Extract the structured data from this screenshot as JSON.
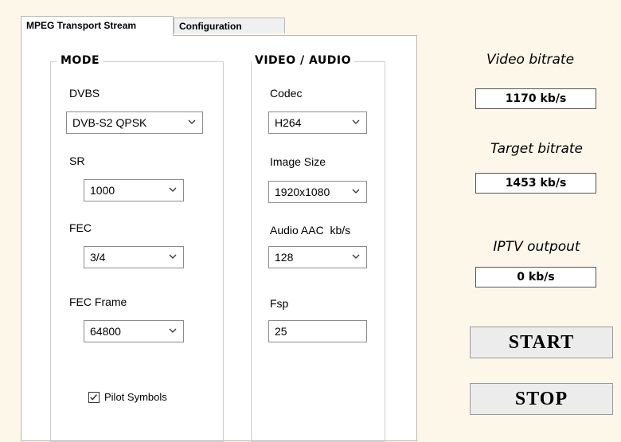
{
  "tabs": [
    {
      "label": "MPEG Transport Stream",
      "active": true
    },
    {
      "label": "Configuration",
      "active": false
    }
  ],
  "mode": {
    "title": "MODE",
    "dvbs_label": "DVBS",
    "dvbs_value": "DVB-S2 QPSK",
    "sr_label": "SR",
    "sr_value": "1000",
    "fec_label": "FEC",
    "fec_value": "3/4",
    "fec_frame_label": "FEC Frame",
    "fec_frame_value": "64800",
    "pilot_label": "Pilot Symbols",
    "pilot_checked": true
  },
  "video_audio": {
    "title": "VIDEO / AUDIO",
    "codec_label": "Codec",
    "codec_value": "H264",
    "image_size_label": "Image Size",
    "image_size_value": "1920x1080",
    "audio_label": "Audio AAC  kb/s",
    "audio_value": "128",
    "fsp_label": "Fsp",
    "fsp_value": "25"
  },
  "stats": {
    "video_bitrate_label": "Video bitrate",
    "video_bitrate_value": "1170 kb/s",
    "target_bitrate_label": "Target bitrate",
    "target_bitrate_value": "1453 kb/s",
    "iptv_label": "IPTV outpout",
    "iptv_value": "0 kb/s"
  },
  "buttons": {
    "start": "START",
    "stop": "STOP"
  },
  "icons": {
    "dropdown": "chevron-down-icon",
    "check": "check-icon"
  }
}
